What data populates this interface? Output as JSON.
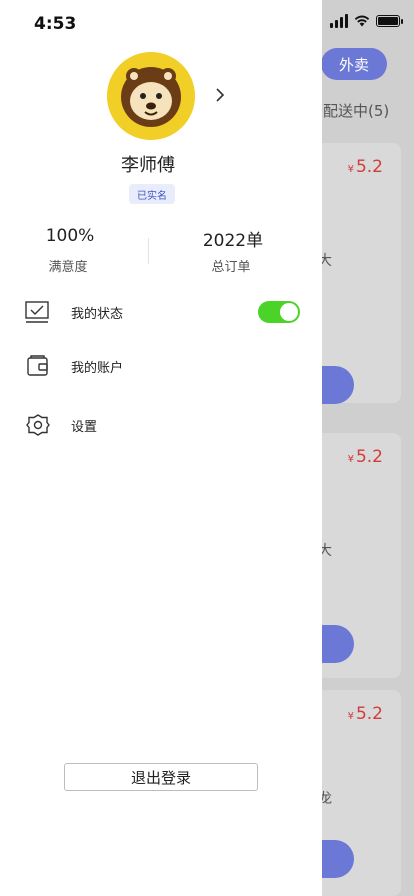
{
  "status_bar": {
    "time": "4:53"
  },
  "drawer": {
    "profile": {
      "name": "李师傅",
      "verified_badge": "已实名"
    },
    "stats": [
      {
        "value": "100%",
        "label": "满意度"
      },
      {
        "value": "2022单",
        "label": "总订单"
      }
    ],
    "menu": [
      {
        "label": "我的状态",
        "icon": "checklist-icon",
        "toggle_on": true
      },
      {
        "label": "我的账户",
        "icon": "wallet-icon"
      },
      {
        "label": "设置",
        "icon": "gear-icon"
      }
    ],
    "logout_label": "退出登录"
  },
  "background": {
    "active_tab": "外卖",
    "subtab": "配送中(5)",
    "cards": [
      {
        "currency": "¥",
        "price": "5.2",
        "fragment": "大"
      },
      {
        "currency": "¥",
        "price": "5.2",
        "fragment": "大"
      },
      {
        "currency": "¥",
        "price": "5.2",
        "fragment": "龙"
      }
    ],
    "colors": {
      "accent": "#6b78d6",
      "price": "#d23c3c",
      "toggle": "#4cd32a"
    }
  }
}
